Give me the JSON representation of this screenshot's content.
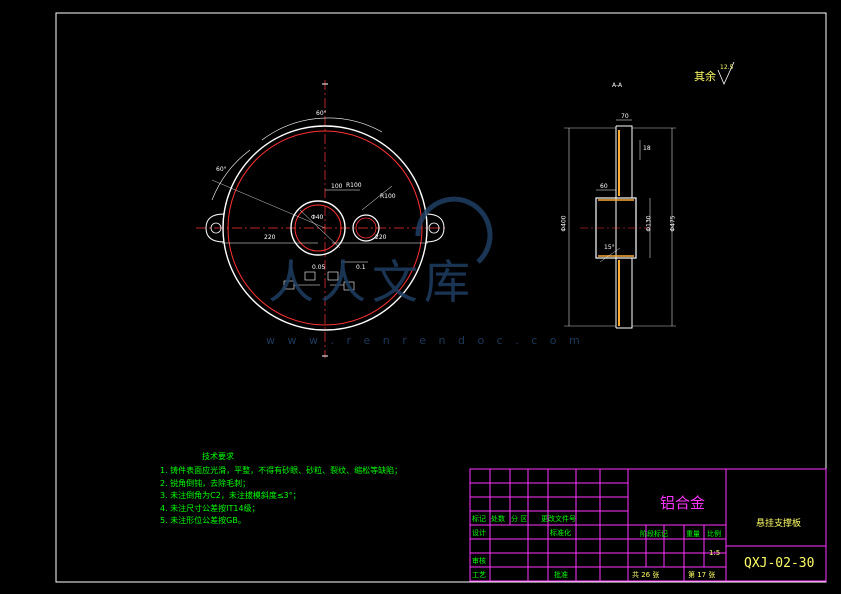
{
  "notes": {
    "title": "技术要求",
    "items": [
      "1. 铸件表面应光滑，平整，不得有砂眼、砂粒、裂纹、缩松等缺陷；",
      "2. 锐角倒钝，去除毛刺；",
      "3. 未注倒角为C2，未注拔模斜度≤3°；",
      "4. 未注尺寸公差按IT14级；",
      "5. 未注形位公差按GB。"
    ]
  },
  "title_block": {
    "material": "铝合金",
    "part_name": "悬挂支撑板",
    "drawing_no": "QXJ-02-30",
    "scale": "1:5",
    "total_sheets": "共 26 张",
    "sheet_no": "第 17 张",
    "labels": {
      "mark": "标记",
      "count": "处数",
      "zone": "分 区",
      "change_doc": "更改文件号",
      "design": "设计",
      "std": "标准化",
      "stage_mark": "阶段标记",
      "weight": "重量",
      "scale": "比例",
      "review": "审核",
      "process": "工艺",
      "approve": "批准"
    }
  },
  "drawing": {
    "section_label": "A-A",
    "roughness_label": "其余",
    "roughness_value": "12.5",
    "dims": {
      "angle_top": "60°",
      "angle_left": "60°",
      "r_small": "R100",
      "hole_dim": "Φ40",
      "d_100": "100",
      "d_r100": "R100",
      "left_220": "220",
      "right_220": "220",
      "sec_70": "70",
      "sec_18": "18",
      "sec_60": "60",
      "sec_dia_outer": "Φ400",
      "sec_dia_right": "Φ475",
      "sec_dia_hub": "Φ130",
      "sec_15": "15°",
      "gd1": "0.1",
      "gd2": "0.05"
    }
  },
  "watermark": {
    "text": "人人文库",
    "url": "w w w . r e n r e n d o c . c o m"
  },
  "colors": {
    "background": "#000000",
    "frame": "#ffffff",
    "part_outline": "#ffffff",
    "part_inner": "#ff3333",
    "centerline": "#ff3333",
    "dimension": "#ffffff",
    "title_block": "#ff33ff",
    "text_green": "#00ff00",
    "text_yellow": "#ffff66",
    "watermark": "#1f3f63"
  }
}
